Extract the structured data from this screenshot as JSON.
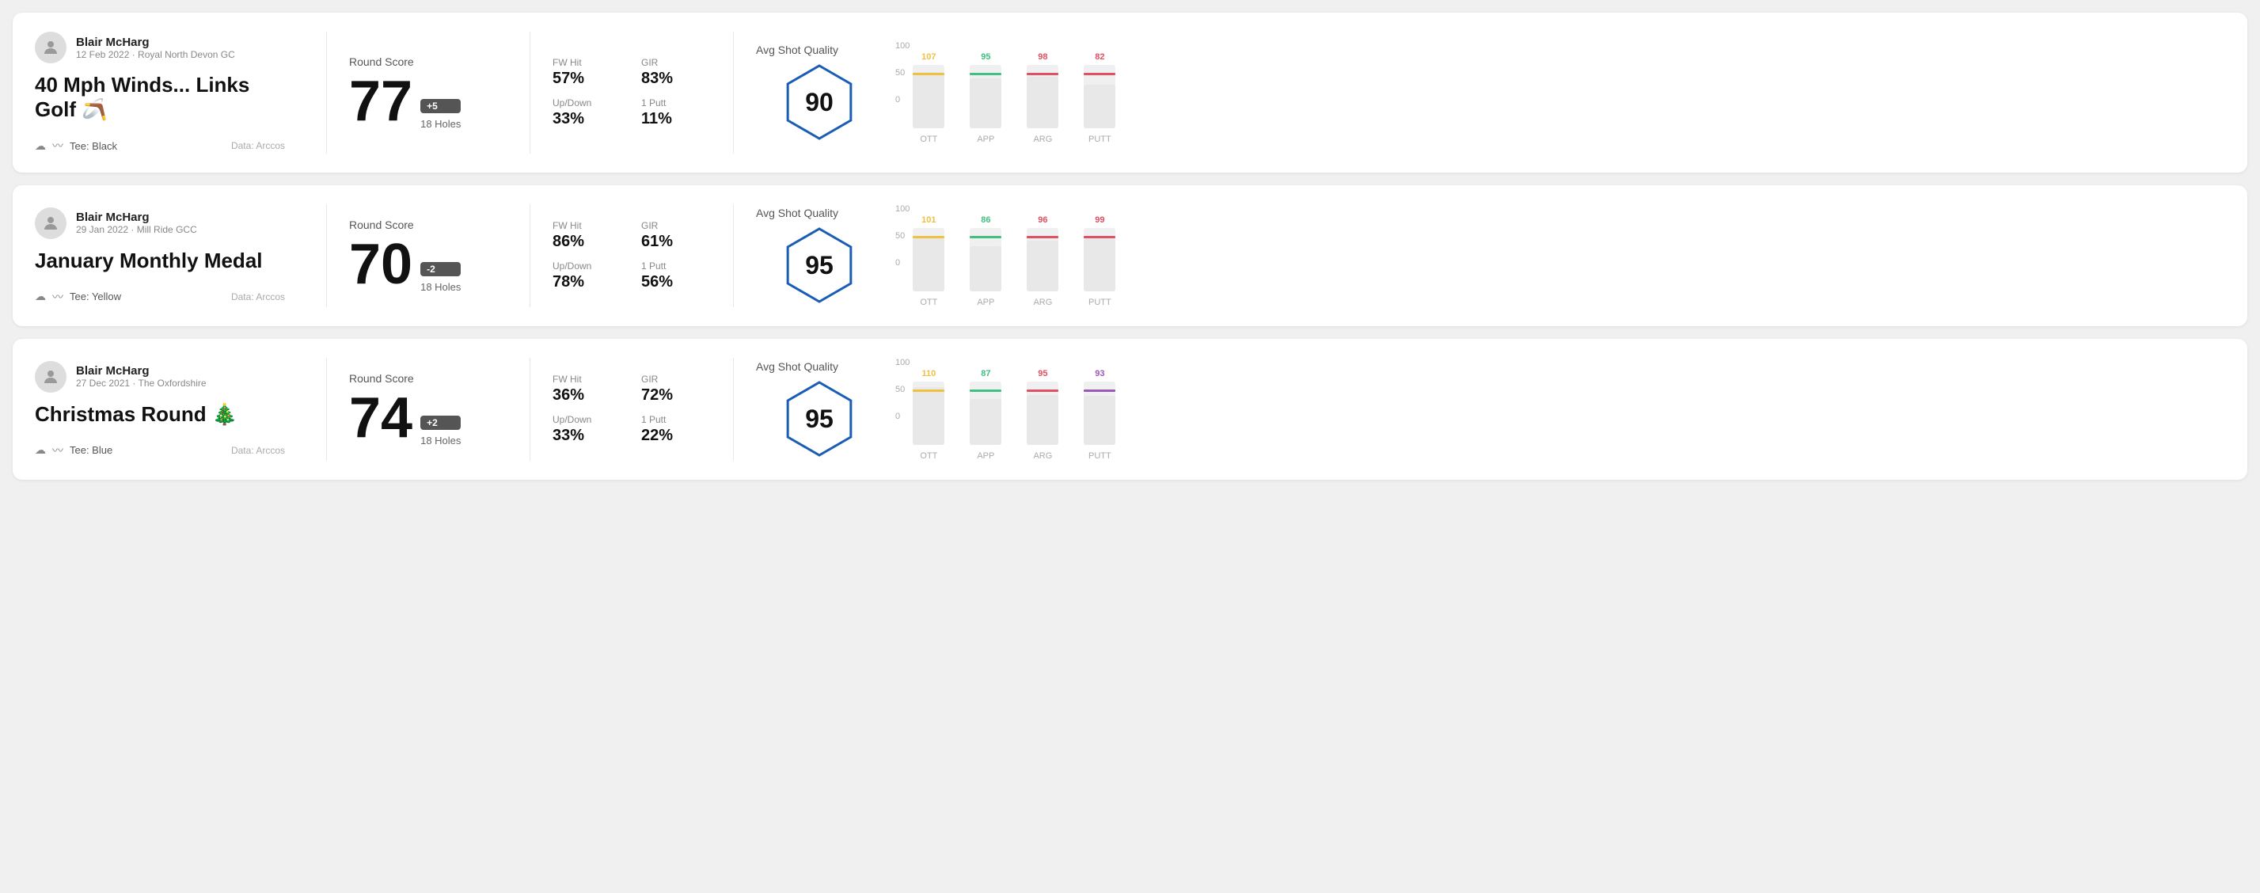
{
  "rounds": [
    {
      "id": "round-1",
      "user": {
        "name": "Blair McHarg",
        "date": "12 Feb 2022",
        "club": "Royal North Devon GC"
      },
      "title": "40 Mph Winds... Links Golf 🪃",
      "tee": "Black",
      "dataSource": "Data: Arccos",
      "score": {
        "value": "77",
        "diff": "+5",
        "holes": "18 Holes"
      },
      "stats": {
        "fwHitLabel": "FW Hit",
        "fwHitValue": "57%",
        "girLabel": "GIR",
        "girValue": "83%",
        "upDownLabel": "Up/Down",
        "upDownValue": "33%",
        "onePuttLabel": "1 Putt",
        "onePuttValue": "11%"
      },
      "quality": {
        "label": "Avg Shot Quality",
        "score": "90"
      },
      "chart": {
        "bars": [
          {
            "label": "OTT",
            "value": 107,
            "color": "#f0c040",
            "maxVal": 120
          },
          {
            "label": "APP",
            "value": 95,
            "color": "#40c080",
            "maxVal": 120
          },
          {
            "label": "ARG",
            "value": 98,
            "color": "#e05060",
            "maxVal": 120
          },
          {
            "label": "PUTT",
            "value": 82,
            "color": "#e05060",
            "maxVal": 120
          }
        ],
        "yLabels": [
          "100",
          "50",
          "0"
        ]
      }
    },
    {
      "id": "round-2",
      "user": {
        "name": "Blair McHarg",
        "date": "29 Jan 2022",
        "club": "Mill Ride GCC"
      },
      "title": "January Monthly Medal",
      "tee": "Yellow",
      "dataSource": "Data: Arccos",
      "score": {
        "value": "70",
        "diff": "-2",
        "holes": "18 Holes"
      },
      "stats": {
        "fwHitLabel": "FW Hit",
        "fwHitValue": "86%",
        "girLabel": "GIR",
        "girValue": "61%",
        "upDownLabel": "Up/Down",
        "upDownValue": "78%",
        "onePuttLabel": "1 Putt",
        "onePuttValue": "56%"
      },
      "quality": {
        "label": "Avg Shot Quality",
        "score": "95"
      },
      "chart": {
        "bars": [
          {
            "label": "OTT",
            "value": 101,
            "color": "#f0c040",
            "maxVal": 120
          },
          {
            "label": "APP",
            "value": 86,
            "color": "#40c080",
            "maxVal": 120
          },
          {
            "label": "ARG",
            "value": 96,
            "color": "#e05060",
            "maxVal": 120
          },
          {
            "label": "PUTT",
            "value": 99,
            "color": "#e05060",
            "maxVal": 120
          }
        ],
        "yLabels": [
          "100",
          "50",
          "0"
        ]
      }
    },
    {
      "id": "round-3",
      "user": {
        "name": "Blair McHarg",
        "date": "27 Dec 2021",
        "club": "The Oxfordshire"
      },
      "title": "Christmas Round 🎄",
      "tee": "Blue",
      "dataSource": "Data: Arccos",
      "score": {
        "value": "74",
        "diff": "+2",
        "holes": "18 Holes"
      },
      "stats": {
        "fwHitLabel": "FW Hit",
        "fwHitValue": "36%",
        "girLabel": "GIR",
        "girValue": "72%",
        "upDownLabel": "Up/Down",
        "upDownValue": "33%",
        "onePuttLabel": "1 Putt",
        "onePuttValue": "22%"
      },
      "quality": {
        "label": "Avg Shot Quality",
        "score": "95"
      },
      "chart": {
        "bars": [
          {
            "label": "OTT",
            "value": 110,
            "color": "#f0c040",
            "maxVal": 120
          },
          {
            "label": "APP",
            "value": 87,
            "color": "#40c080",
            "maxVal": 120
          },
          {
            "label": "ARG",
            "value": 95,
            "color": "#e05060",
            "maxVal": 120
          },
          {
            "label": "PUTT",
            "value": 93,
            "color": "#9b59b6",
            "maxVal": 120
          }
        ],
        "yLabels": [
          "100",
          "50",
          "0"
        ]
      }
    }
  ],
  "labels": {
    "roundScore": "Round Score",
    "avgShotQuality": "Avg Shot Quality",
    "dataArccos": "Data: Arccos",
    "tee": "Tee:"
  }
}
